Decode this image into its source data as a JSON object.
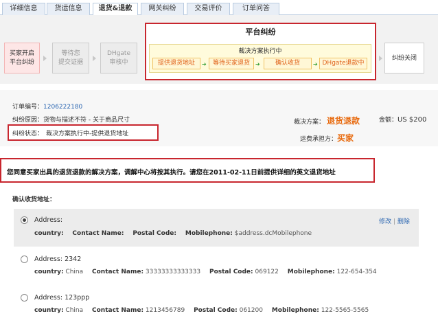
{
  "tabs": [
    {
      "label": "详细信息"
    },
    {
      "label": "货运信息"
    },
    {
      "label": "退货&退款"
    },
    {
      "label": "网关纠纷"
    },
    {
      "label": "交易评价"
    },
    {
      "label": "订单问答"
    }
  ],
  "process": {
    "buyer_open": {
      "line1": "买家开启",
      "line2": "平台纠纷"
    },
    "wait_evidence": {
      "line1": "等待您",
      "line2": "提交证据"
    },
    "dhgate_review": {
      "line1": "DHgate",
      "line2": "审核中"
    },
    "platform_title": "平台纠纷",
    "exec_title": "裁决方案执行中",
    "exec_steps": [
      "提供退货地址",
      "等待买家退货",
      "确认收货",
      "DHgate退款中"
    ],
    "closed": "纠纷关闭"
  },
  "order": {
    "number_label": "订单编号：",
    "number": "1206222180",
    "reason_label": "纠纷原因：",
    "reason": "货物与描述不符 - 关于商品尺寸",
    "status_label": "纠纷状态：",
    "status": "裁决方案执行中-提供退货地址",
    "verdict_label": "裁决方案：",
    "verdict": "退货退款",
    "amount_label": "金额：",
    "amount": "US $200",
    "shipping_label": "运费承担方：",
    "shipping_party": "买家"
  },
  "notice": "您同意买家出具的退货退款的解决方案，调解中心将按其执行。请您在2011-02-11日前提供详细的英文退货地址",
  "address_section": {
    "title": "确认收货地址：",
    "edit": "修改",
    "separator": "|",
    "delete": "删除",
    "keys": {
      "address": "Address:",
      "country": "country:",
      "contact": "Contact Name:",
      "postal": "Postal Code:",
      "mobile": "Mobilephone:"
    },
    "items": [
      {
        "address": "",
        "country": "",
        "contact": "",
        "postal": "",
        "mobile": "$address.dcMobilephone",
        "selected": true
      },
      {
        "address": "2342",
        "country": "China",
        "contact": "33333333333333",
        "postal": "069122",
        "mobile": "122-654-354",
        "selected": false
      },
      {
        "address": "123ppp",
        "country": "China",
        "contact": "1213456789",
        "postal": "061200",
        "mobile": "122-5565-5565",
        "selected": false
      }
    ]
  },
  "colors": {
    "accent_red": "#c8262e",
    "orange": "#e86b10",
    "link_blue": "#2b66b1",
    "tab_bg": "#e8eef6"
  }
}
